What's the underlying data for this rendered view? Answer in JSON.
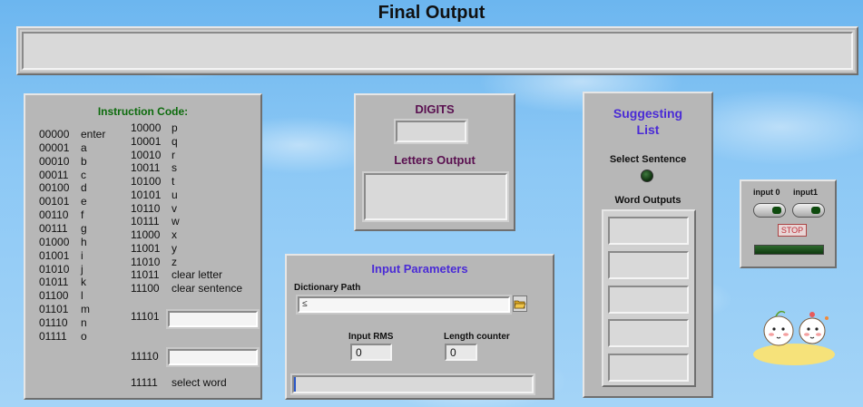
{
  "final_output": {
    "title": "Final Output",
    "value": ""
  },
  "instruction": {
    "title": "Instruction Code:",
    "col1": [
      {
        "code": "00000",
        "label": "enter"
      },
      {
        "code": "00001",
        "label": "a"
      },
      {
        "code": "00010",
        "label": "b"
      },
      {
        "code": "00011",
        "label": "c"
      },
      {
        "code": "00100",
        "label": "d"
      },
      {
        "code": "00101",
        "label": "e"
      },
      {
        "code": "00110",
        "label": "f"
      },
      {
        "code": "00111",
        "label": "g"
      },
      {
        "code": "01000",
        "label": "h"
      },
      {
        "code": "01001",
        "label": "i"
      },
      {
        "code": "01010",
        "label": "j"
      },
      {
        "code": "01011",
        "label": "k"
      },
      {
        "code": "01100",
        "label": "l"
      },
      {
        "code": "01101",
        "label": "m"
      },
      {
        "code": "01110",
        "label": "n"
      },
      {
        "code": "01111",
        "label": "o"
      }
    ],
    "col2": [
      {
        "code": "10000",
        "label": "p"
      },
      {
        "code": "10001",
        "label": "q"
      },
      {
        "code": "10010",
        "label": "r"
      },
      {
        "code": "10011",
        "label": "s"
      },
      {
        "code": "10100",
        "label": "t"
      },
      {
        "code": "10101",
        "label": "u"
      },
      {
        "code": "10110",
        "label": "v"
      },
      {
        "code": "10111",
        "label": "w"
      },
      {
        "code": "11000",
        "label": "x"
      },
      {
        "code": "11001",
        "label": "y"
      },
      {
        "code": "11010",
        "label": "z"
      },
      {
        "code": "11011",
        "label": "clear letter"
      },
      {
        "code": "11100",
        "label": "clear sentence"
      }
    ],
    "code_11101": "11101",
    "code_11110": "11110",
    "code_11111": "11111",
    "select_word": "select word"
  },
  "digits": {
    "title": "DIGITS",
    "value": ""
  },
  "letters_output": {
    "title": "Letters Output",
    "value": ""
  },
  "input_params": {
    "title": "Input Parameters",
    "dictionary_path_label": "Dictionary Path",
    "dictionary_path_value": "",
    "input_rms_label": "Input RMS",
    "input_rms_value": "0",
    "length_counter_label": "Length counter",
    "length_counter_value": "0"
  },
  "suggesting": {
    "title_line1": "Suggesting",
    "title_line2": "List",
    "select_sentence": "Select Sentence",
    "word_outputs": "Word Outputs"
  },
  "controls": {
    "input0": "input 0",
    "input1": "input1",
    "stop": "STOP"
  },
  "colors": {
    "panel": "#b7b7b7",
    "accent_blue": "#4a2bd6",
    "accent_green": "#0d6b0d",
    "led_off": "#0c2e0c"
  }
}
